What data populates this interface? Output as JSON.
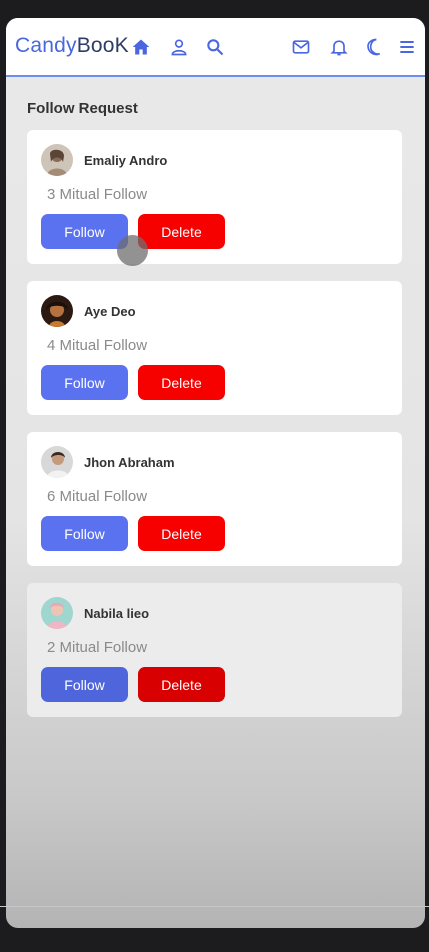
{
  "app": {
    "logo_part1": "Candy",
    "logo_part2": "BooK",
    "nav_icons": [
      "home-icon",
      "user-icon",
      "search-icon",
      "mail-icon",
      "bell-icon",
      "moon-icon",
      "menu-icon"
    ],
    "accent": "#5b72f0",
    "danger": "#f70000"
  },
  "section": {
    "title": "Follow Request"
  },
  "requests": [
    {
      "name": "Emaliy Andro",
      "mutual": "3 Mitual Follow",
      "follow_label": "Follow",
      "delete_label": "Delete"
    },
    {
      "name": "Aye Deo",
      "mutual": "4 Mitual Follow",
      "follow_label": "Follow",
      "delete_label": "Delete"
    },
    {
      "name": "Jhon Abraham",
      "mutual": "6 Mitual Follow",
      "follow_label": "Follow",
      "delete_label": "Delete"
    },
    {
      "name": "Nabila lieo",
      "mutual": "2 Mitual Follow",
      "follow_label": "Follow",
      "delete_label": "Delete"
    }
  ]
}
